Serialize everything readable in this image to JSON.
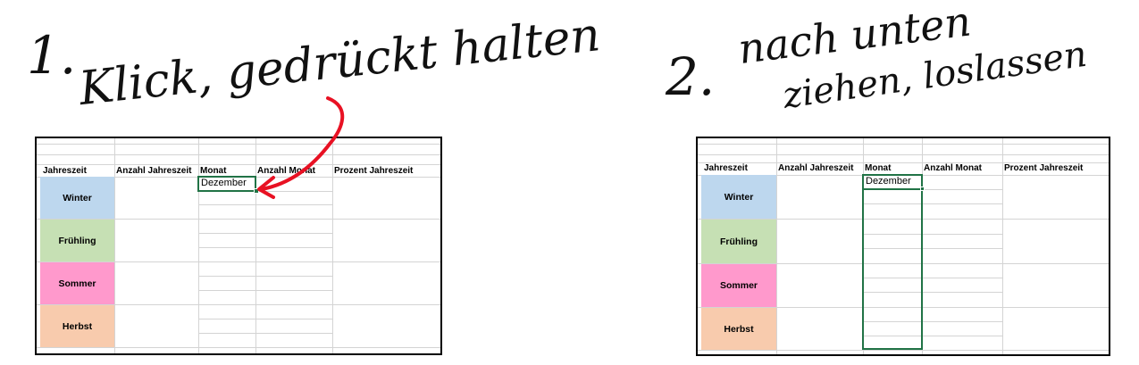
{
  "instructions": {
    "step1_number": "1.",
    "step1_text": "Klick, gedrückt halten",
    "step2_number": "2.",
    "step2_line1": "nach unten",
    "step2_line2": "ziehen, loslassen"
  },
  "spreadsheet": {
    "headers": [
      "Jahreszeit",
      "Anzahl Jahreszeit",
      "Monat",
      "Anzahl Monat",
      "Prozent Jahreszeit"
    ],
    "seasons": [
      {
        "name": "Winter",
        "color": "#bdd7ee"
      },
      {
        "name": "Frühling",
        "color": "#c6e0b4"
      },
      {
        "name": "Sommer",
        "color": "#ff99cc"
      },
      {
        "name": "Herbst",
        "color": "#f8cbad"
      }
    ],
    "selected_cell_value": "Dezember"
  },
  "colors": {
    "selection": "#217346",
    "arrow": "#e81123"
  }
}
